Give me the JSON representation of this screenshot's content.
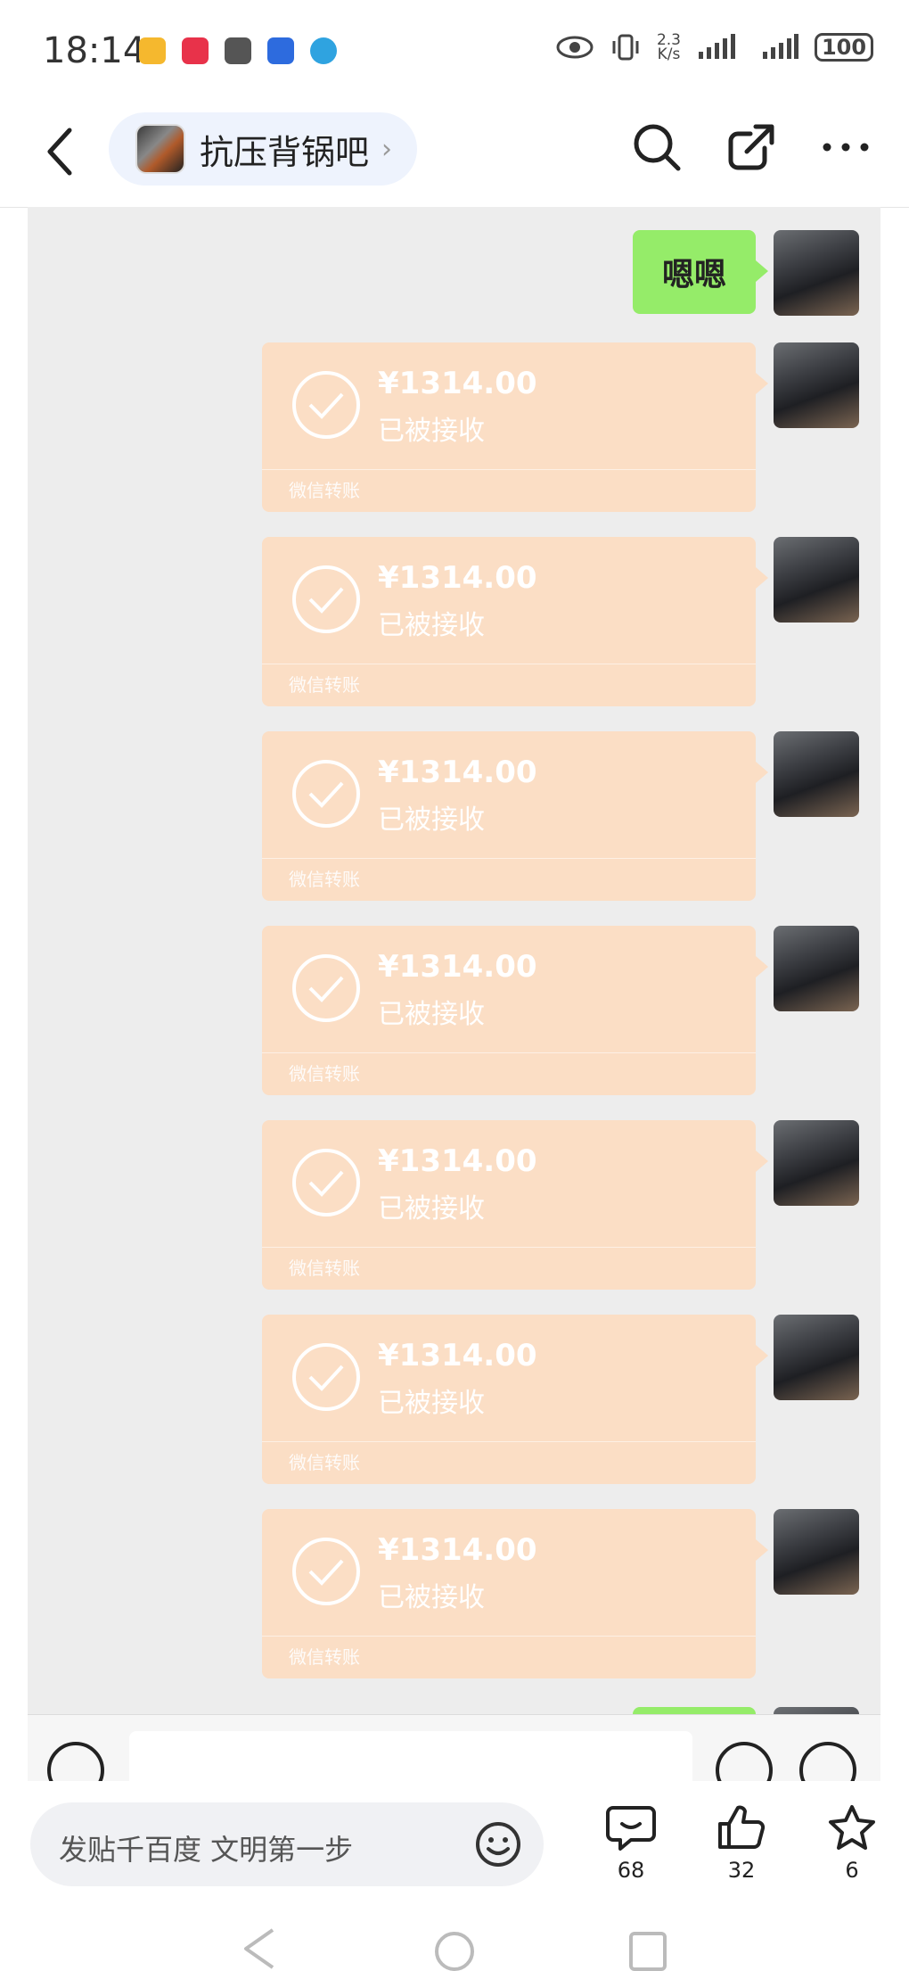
{
  "status_bar": {
    "time": "18:14",
    "notifications": [
      {
        "name": "weibo-icon",
        "color": "#f5b82e"
      },
      {
        "name": "xiaohongshu-icon",
        "color": "#e8324a"
      },
      {
        "name": "app-icon",
        "color": "#555555"
      },
      {
        "name": "baidu-icon",
        "color": "#2d6bde"
      },
      {
        "name": "browser-icon",
        "color": "#2fa3e0"
      }
    ],
    "net_speed_value": "2.3",
    "net_speed_unit": "K/s",
    "battery": "100"
  },
  "header": {
    "forum_name": "抗压背锅吧",
    "back_icon": "chevron-left-icon",
    "search_icon": "search-icon",
    "share_icon": "share-icon",
    "more_icon": "more-icon"
  },
  "chat": {
    "text_message": "嗯嗯",
    "transfers": [
      {
        "amount": "¥1314.00",
        "status": "已被接收",
        "footer": "微信转账"
      },
      {
        "amount": "¥1314.00",
        "status": "已被接收",
        "footer": "微信转账"
      },
      {
        "amount": "¥1314.00",
        "status": "已被接收",
        "footer": "微信转账"
      },
      {
        "amount": "¥1314.00",
        "status": "已被接收",
        "footer": "微信转账"
      },
      {
        "amount": "¥1314.00",
        "status": "已被接收",
        "footer": "微信转账"
      },
      {
        "amount": "¥1314.00",
        "status": "已被接收",
        "footer": "微信转账"
      },
      {
        "amount": "¥1314.00",
        "status": "已被接收",
        "footer": "微信转账"
      }
    ],
    "colors": {
      "green_bubble": "#95ec69",
      "transfer_bubble": "#fbdec5",
      "background": "#ededed"
    }
  },
  "bottom": {
    "reply_placeholder": "发贴千百度 文明第一步",
    "comments_count": "68",
    "likes_count": "32",
    "favorites_count": "6"
  }
}
